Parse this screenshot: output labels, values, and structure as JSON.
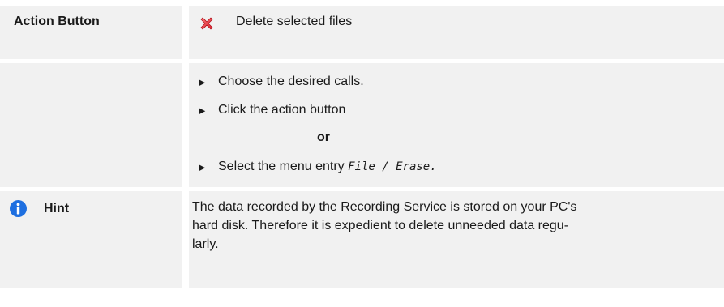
{
  "action_row": {
    "label": "Action Button",
    "icon": "delete-x-icon",
    "icon_color": "#e8323c",
    "text": "Delete selected files"
  },
  "steps": {
    "step1": "Choose the desired calls.",
    "step2": "Click the action button",
    "or_label": "or",
    "step3_prefix": "Select the menu entry ",
    "step3_menu": "File / Erase",
    "step3_suffix": "."
  },
  "hint": {
    "icon": "info-icon",
    "icon_color": "#1e6fe0",
    "label": "Hint",
    "lines": [
      "The data recorded by the Recording Service is stored on your PC's",
      "hard disk. Therefore it is expedient to delete unneeded data regu-",
      "larly."
    ]
  }
}
